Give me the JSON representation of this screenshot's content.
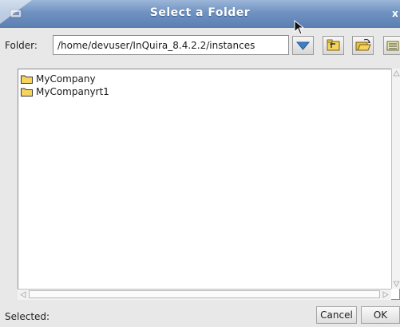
{
  "window": {
    "title": "Select a Folder",
    "close_label": "x"
  },
  "folder_row": {
    "label": "Folder:",
    "path_value": "/home/devuser/InQuira_8.4.2.2/instances"
  },
  "list": {
    "items": [
      {
        "label": "MyCompany",
        "icon": "folder-icon"
      },
      {
        "label": "MyCompanyrt1",
        "icon": "folder-icon"
      }
    ]
  },
  "bottom": {
    "selected_label": "Selected:",
    "cancel_label": "Cancel",
    "ok_label": "OK"
  },
  "colors": {
    "titlebar": "#6f92c1",
    "folder_icon": "#f5d35c",
    "dropdown_arrow": "#3d7fc2"
  }
}
